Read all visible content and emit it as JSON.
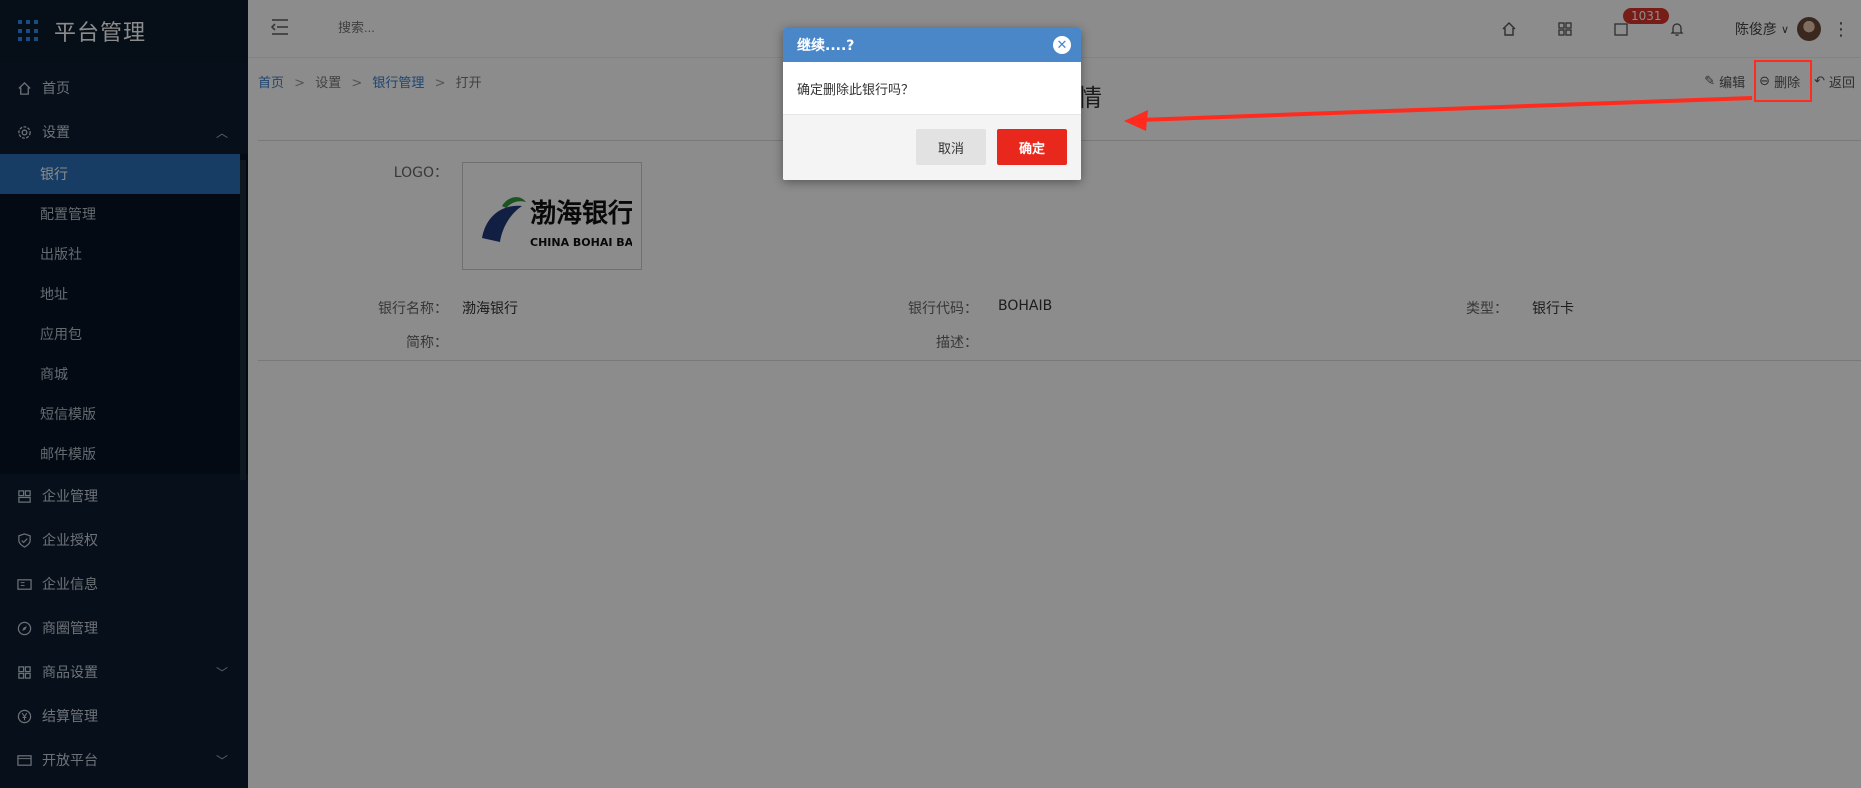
{
  "app": {
    "title": "平台管理"
  },
  "sidebar": {
    "items": [
      {
        "label": "首页",
        "icon": "home-icon"
      },
      {
        "label": "设置",
        "icon": "gear-icon",
        "expanded": true
      },
      {
        "label": "企业管理",
        "icon": "building-icon"
      },
      {
        "label": "企业授权",
        "icon": "shield-icon"
      },
      {
        "label": "企业信息",
        "icon": "id-card-icon"
      },
      {
        "label": "商圈管理",
        "icon": "compass-icon"
      },
      {
        "label": "商品设置",
        "icon": "grid-icon"
      },
      {
        "label": "结算管理",
        "icon": "yen-icon"
      },
      {
        "label": "开放平台",
        "icon": "window-icon"
      }
    ],
    "submenu": [
      "银行",
      "配置管理",
      "出版社",
      "地址",
      "应用包",
      "商城",
      "短信模版",
      "邮件模版"
    ]
  },
  "topbar": {
    "search_placeholder": "搜索...",
    "badge_count": "1031",
    "user_name": "陈俊彦"
  },
  "breadcrumb": {
    "home": "首页",
    "settings": "设置",
    "bank_mgmt": "银行管理",
    "current": "打开"
  },
  "actions": {
    "edit": "编辑",
    "delete": "删除",
    "back": "返回"
  },
  "page": {
    "title_fragment": "情"
  },
  "detail": {
    "logo_label": "LOGO：",
    "logo_text": "渤海银行",
    "logo_subtext": "CHINA BOHAI BANK",
    "bank_name_label": "银行名称：",
    "bank_name": "渤海银行",
    "bank_code_label": "银行代码：",
    "bank_code": "BOHAIB",
    "type_label": "类型：",
    "type": "银行卡",
    "short_label": "简称：",
    "desc_label": "描述："
  },
  "modal": {
    "title": "继续....?",
    "message": "确定删除此银行吗？",
    "cancel": "取消",
    "ok": "确定"
  },
  "colors": {
    "accent": "#4a87c8",
    "danger": "#e8281c",
    "sidebar": "#0d1d30"
  }
}
